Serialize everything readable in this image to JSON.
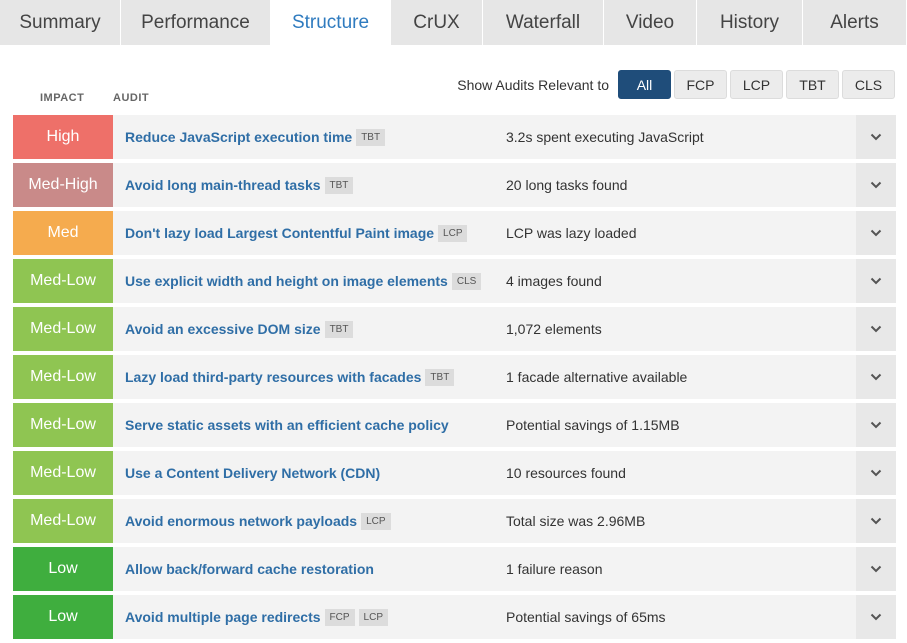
{
  "tabs": [
    {
      "label": "Summary",
      "active": false
    },
    {
      "label": "Performance",
      "active": false
    },
    {
      "label": "Structure",
      "active": true
    },
    {
      "label": "CrUX",
      "active": false
    },
    {
      "label": "Waterfall",
      "active": false
    },
    {
      "label": "Video",
      "active": false
    },
    {
      "label": "History",
      "active": false
    },
    {
      "label": "Alerts",
      "active": false
    }
  ],
  "header": {
    "impact_label": "IMPACT",
    "audit_label": "AUDIT",
    "filter_label": "Show Audits Relevant to",
    "filters": [
      {
        "label": "All",
        "active": true
      },
      {
        "label": "FCP",
        "active": false
      },
      {
        "label": "LCP",
        "active": false
      },
      {
        "label": "TBT",
        "active": false
      },
      {
        "label": "CLS",
        "active": false
      }
    ]
  },
  "impact_colors": {
    "High": "#ee7069",
    "Med-High": "#c98a89",
    "Med": "#f5ab4e",
    "Med-Low": "#8fc552",
    "Low": "#3fae3e"
  },
  "audits": [
    {
      "impact": "High",
      "title": "Reduce JavaScript execution time",
      "tags": [
        "TBT"
      ],
      "result": "3.2s spent executing JavaScript"
    },
    {
      "impact": "Med-High",
      "title": "Avoid long main-thread tasks",
      "tags": [
        "TBT"
      ],
      "result": "20 long tasks found"
    },
    {
      "impact": "Med",
      "title": "Don't lazy load Largest Contentful Paint image",
      "tags": [
        "LCP"
      ],
      "result": "LCP was lazy loaded"
    },
    {
      "impact": "Med-Low",
      "title": "Use explicit width and height on image elements",
      "tags": [
        "CLS"
      ],
      "result": "4 images found"
    },
    {
      "impact": "Med-Low",
      "title": "Avoid an excessive DOM size",
      "tags": [
        "TBT"
      ],
      "result": "1,072 elements"
    },
    {
      "impact": "Med-Low",
      "title": "Lazy load third-party resources with facades",
      "tags": [
        "TBT"
      ],
      "result": "1 facade alternative available"
    },
    {
      "impact": "Med-Low",
      "title": "Serve static assets with an efficient cache policy",
      "tags": [],
      "result": "Potential savings of 1.15MB"
    },
    {
      "impact": "Med-Low",
      "title": "Use a Content Delivery Network (CDN)",
      "tags": [],
      "result": "10 resources found"
    },
    {
      "impact": "Med-Low",
      "title": "Avoid enormous network payloads",
      "tags": [
        "LCP"
      ],
      "result": "Total size was 2.96MB"
    },
    {
      "impact": "Low",
      "title": "Allow back/forward cache restoration",
      "tags": [],
      "result": "1 failure reason"
    },
    {
      "impact": "Low",
      "title": "Avoid multiple page redirects",
      "tags": [
        "FCP",
        "LCP"
      ],
      "result": "Potential savings of 65ms"
    }
  ]
}
